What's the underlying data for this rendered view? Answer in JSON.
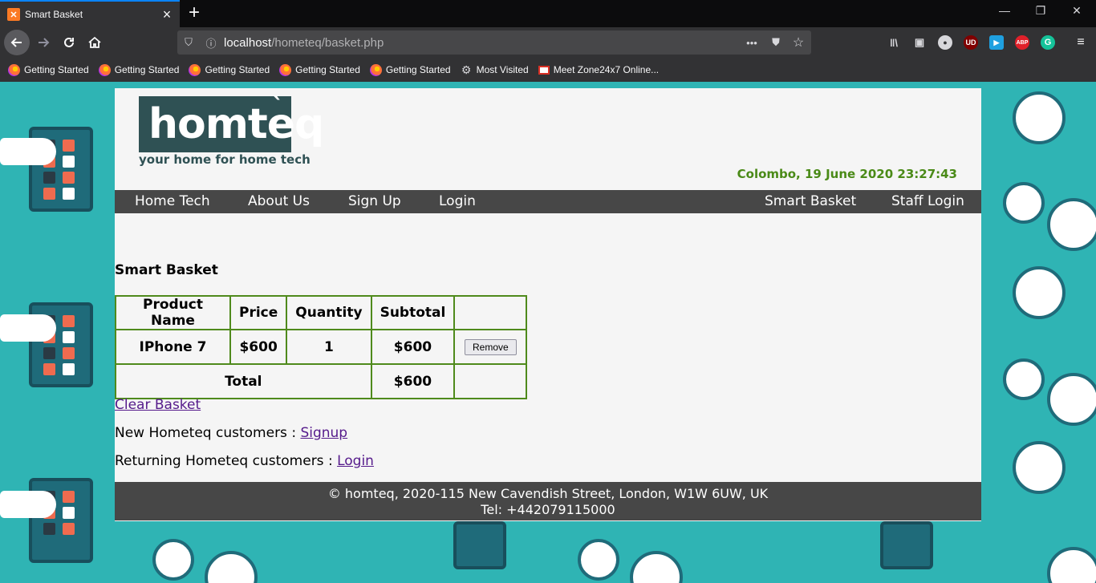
{
  "browser": {
    "tab_title": "Smart Basket",
    "tab_favicon": "xampp-icon",
    "url_host": "localhost",
    "url_path": "/hometeq/basket.php",
    "bookmarks": [
      {
        "label": "Getting Started",
        "icon": "firefox-icon"
      },
      {
        "label": "Getting Started",
        "icon": "firefox-icon"
      },
      {
        "label": "Getting Started",
        "icon": "firefox-icon"
      },
      {
        "label": "Getting Started",
        "icon": "firefox-icon"
      },
      {
        "label": "Getting Started",
        "icon": "firefox-icon"
      },
      {
        "label": "Most Visited",
        "icon": "gear-icon"
      },
      {
        "label": "Meet Zone24x7 Online...",
        "icon": "gmail-icon"
      }
    ],
    "extensions": {
      "ublock": "UD",
      "abp": "ABP",
      "grammarly": "G"
    }
  },
  "site": {
    "logo_text": "homteq",
    "logo_tick": "`",
    "tagline": "your home for home tech",
    "dateline": "Colombo, 19 June 2020 23:27:43",
    "nav_left": [
      "Home Tech",
      "About Us",
      "Sign Up",
      "Login"
    ],
    "nav_right": [
      "Smart Basket",
      "Staff Login"
    ]
  },
  "basket": {
    "title": "Smart Basket",
    "headers": [
      "Product Name",
      "Price",
      "Quantity",
      "Subtotal",
      ""
    ],
    "rows": [
      {
        "product": "IPhone 7",
        "price": "$600",
        "quantity": "1",
        "subtotal": "$600",
        "action": "Remove"
      }
    ],
    "total_label": "Total",
    "total_value": "$600"
  },
  "links": {
    "clear_basket": "Clear Basket",
    "new_customers_text": "New Hometeq customers : ",
    "signup": "Signup",
    "returning_text": "Returning Hometeq customers : ",
    "login": "Login"
  },
  "footer": {
    "line1": "© homteq, 2020-115 New Cavendish Street, London, W1W 6UW, UK",
    "line2": "Tel: +442079115000"
  },
  "colors": {
    "accent": "#4a8a17",
    "nav_bg": "#474747",
    "page_bg": "#2fb4b4",
    "logo_bg": "#2f5154"
  }
}
